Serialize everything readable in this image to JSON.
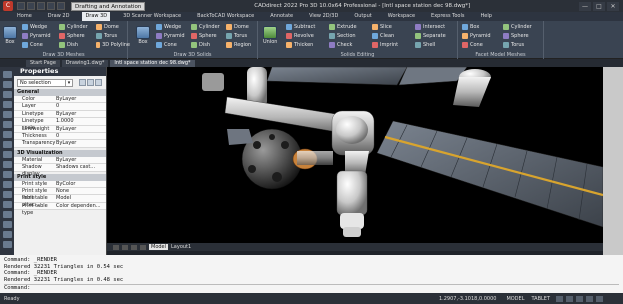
{
  "titlebar": {
    "app_icon": "C",
    "workspace": "Drafting and Annotation",
    "title": "CADdirect 2022 Pro 3D 10.0x64 Professional - [Intl space station dec 98.dwg*]",
    "min": "—",
    "max": "□",
    "close": "✕"
  },
  "ribbon_tabs": [
    "Home",
    "Draw 2D",
    "Draw 3D",
    "3D Scanner Workspace",
    "BackToCAD Workspace",
    "Annotate",
    "View 2D/3D",
    "Output",
    "Workspace",
    "Express Tools",
    "Help"
  ],
  "ribbon_active_tab": 2,
  "ribbon": {
    "mesh_panel": {
      "big_label": "Box",
      "items": [
        "Wedge",
        "Cylinder",
        "Dome",
        "Pyramid",
        "Sphere",
        "Torus",
        "Cone",
        "Dish",
        "3D Polyline"
      ],
      "title": "Draw 3D Meshes"
    },
    "solids_panel": {
      "big_label": "Box",
      "items": [
        "Wedge",
        "Cylinder",
        "Dome",
        "Pyramid",
        "Sphere",
        "Torus",
        "Cone",
        "Dish",
        "Region"
      ],
      "title": "Draw 3D Solids"
    },
    "editing_panel": {
      "big_label": "Union",
      "items": [
        "Subtract",
        "Extrude",
        "Slice",
        "Intersect",
        "Revolve",
        "Section",
        "Clean",
        "Separate",
        "Thicken",
        "Check",
        "Imprint",
        "Shell"
      ],
      "title": "Solids Editing"
    },
    "facet_panel": {
      "items": [
        "Box",
        "Cylinder",
        "Pyramid",
        "Sphere",
        "Cone",
        "Torus"
      ],
      "title": "Facet Model Meshes"
    }
  },
  "doc_tabs": [
    "Start Page",
    "Drawing1.dwg*",
    "Intl space station dec 98.dwg*"
  ],
  "doc_active": 2,
  "properties": {
    "title": "Properties",
    "selection": "No selection",
    "groups": [
      {
        "name": "General",
        "rows": [
          {
            "k": "Color",
            "v": "ByLayer"
          },
          {
            "k": "Layer",
            "v": "0"
          },
          {
            "k": "Linetype",
            "v": "ByLayer"
          },
          {
            "k": "Linetype scale",
            "v": "1.0000"
          },
          {
            "k": "Lineweight",
            "v": "ByLayer"
          },
          {
            "k": "Thickness",
            "v": "0"
          },
          {
            "k": "Transparency",
            "v": "ByLayer"
          }
        ]
      },
      {
        "name": "3D Visualization",
        "rows": [
          {
            "k": "Material",
            "v": "ByLayer"
          },
          {
            "k": "Shadow display",
            "v": "Shadows cast..."
          }
        ]
      },
      {
        "name": "Print style",
        "rows": [
          {
            "k": "Print style",
            "v": "ByColor"
          },
          {
            "k": "Print style table",
            "v": "None"
          },
          {
            "k": "Print table attac...",
            "v": "Model"
          },
          {
            "k": "Print table type",
            "v": "Color dependen..."
          }
        ]
      }
    ]
  },
  "layout_tabs": [
    "Model",
    "Layout1"
  ],
  "command_lines": [
    "Command: _RENDER",
    "Rendered 32231 Triangles in 0.54 sec",
    "Command: _RENDER",
    "Rendered 32231 Triangles in 0.48 sec"
  ],
  "command_prompt": "Command:",
  "status": {
    "ready": "Ready",
    "coords": "1.2907,-3.1018,0.0000",
    "modes": [
      "MODEL",
      "TABLET"
    ]
  },
  "colors": {
    "accent": "#d8a42e",
    "viewport_bg": "#000000"
  }
}
